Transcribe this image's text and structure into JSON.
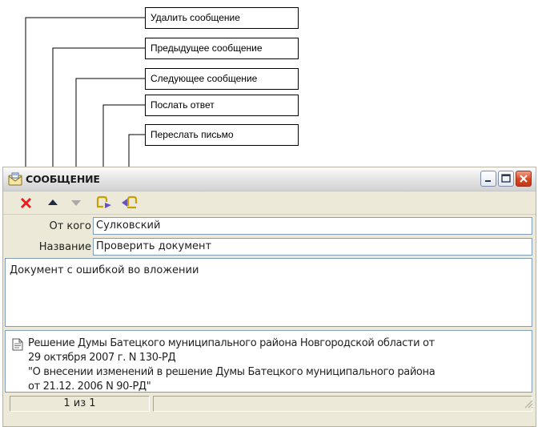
{
  "callouts": [
    {
      "label": "Удалить сообщение"
    },
    {
      "label": "Предыдущее сообщение"
    },
    {
      "label": "Следующее сообщение"
    },
    {
      "label": "Послать ответ"
    },
    {
      "label": "Переслать письмо"
    }
  ],
  "window": {
    "title": "СООБЩЕНИЕ",
    "icon": "envelope-app-icon",
    "controls": [
      "minimize-icon",
      "maximize-icon",
      "close-icon"
    ]
  },
  "toolbar": {
    "buttons": [
      {
        "icon": "delete-x-icon",
        "color": "#e81c1c"
      },
      {
        "icon": "arrow-up-icon",
        "color": "#1f2a44"
      },
      {
        "icon": "arrow-down-icon",
        "color": "#a9a9a9"
      },
      {
        "icon": "reply-icon",
        "color": "#c8a000"
      },
      {
        "icon": "forward-icon",
        "color": "#c8a000"
      }
    ]
  },
  "fields": {
    "from_label": "От кого",
    "from_value": "Сулковский",
    "subject_label": "Название",
    "subject_value": "Проверить документ"
  },
  "message": {
    "body": "Документ с ошибкой во вложении"
  },
  "attachment": {
    "icon": "document-icon",
    "lines": [
      "Решение Думы Батецкого муниципального района Новгородской области от",
      "29 октября 2007 г. N 130-РД",
      "\"О внесении изменений в решение Думы Батецкого муниципального района",
      "от 21.12. 2006 N 90-РД\""
    ]
  },
  "status": {
    "position": "1 из 1"
  },
  "colors": {
    "window_bg": "#ece9d8",
    "input_border": "#7f9db9",
    "close_button": "#d9451f"
  }
}
